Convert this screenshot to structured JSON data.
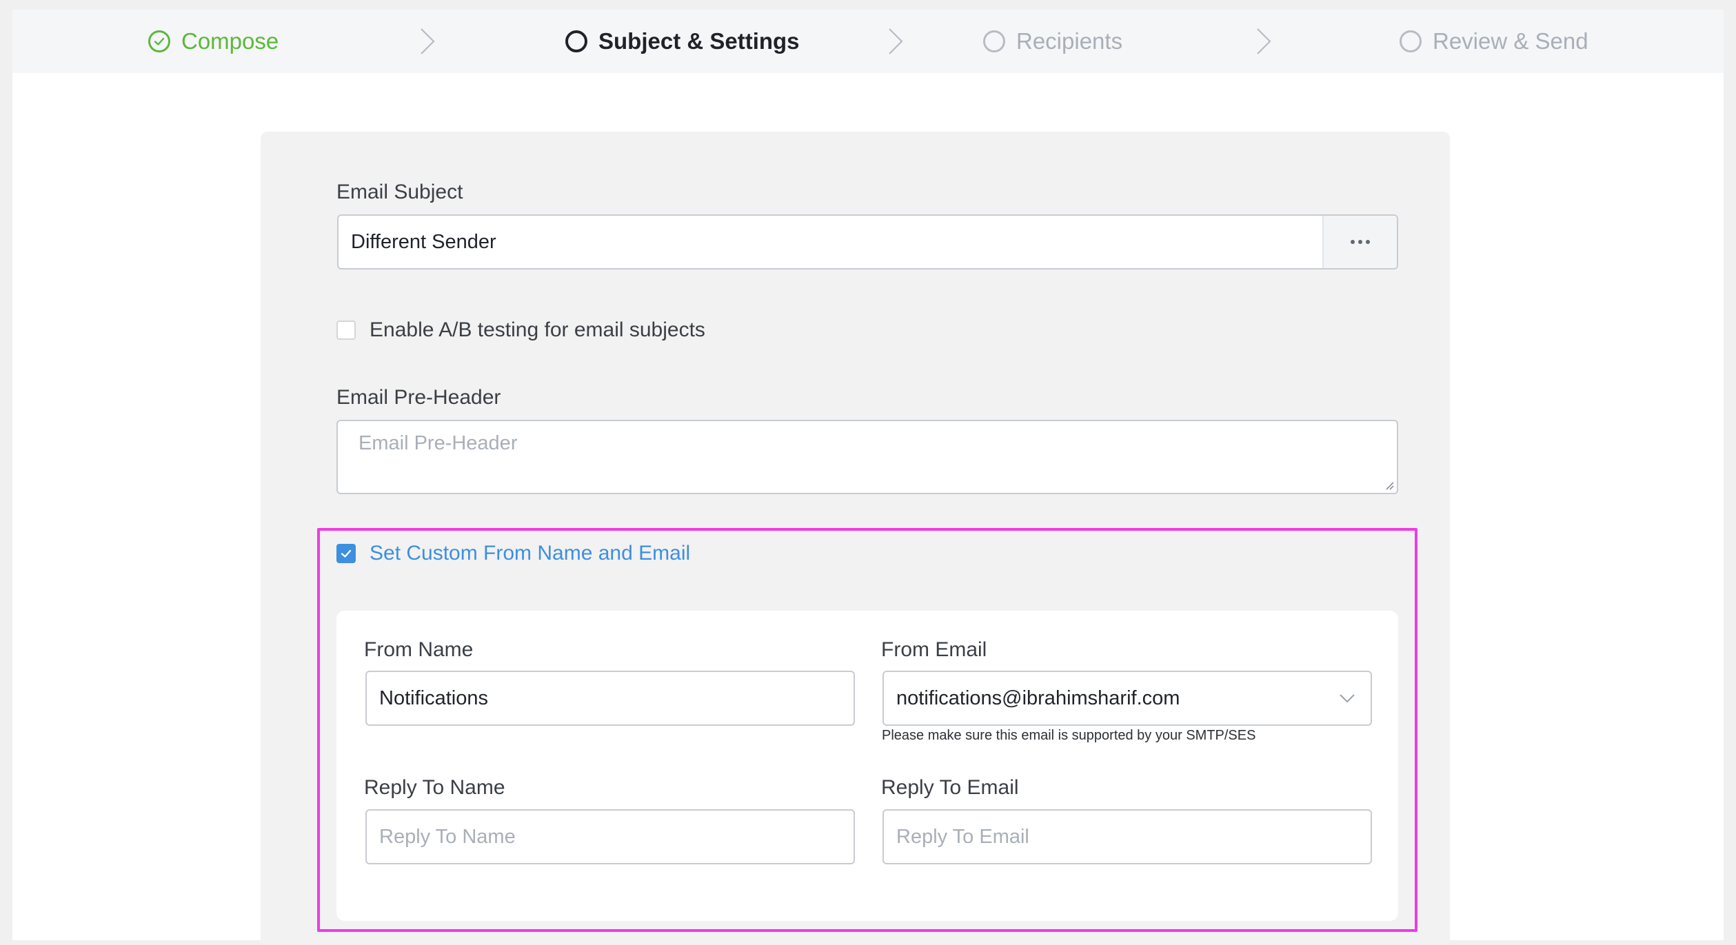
{
  "stepper": {
    "steps": [
      {
        "label": "Compose",
        "state": "done"
      },
      {
        "label": "Subject & Settings",
        "state": "active"
      },
      {
        "label": "Recipients",
        "state": "pending"
      },
      {
        "label": "Review & Send",
        "state": "pending"
      }
    ]
  },
  "form": {
    "subject_label": "Email Subject",
    "subject_value": "Different Sender",
    "ab_testing_label": "Enable A/B testing for email subjects",
    "ab_testing_checked": false,
    "preheader_label": "Email Pre-Header",
    "preheader_placeholder": "Email Pre-Header",
    "custom_from_label": "Set Custom From Name and Email",
    "custom_from_checked": true,
    "from_name_label": "From Name",
    "from_name_value": "Notifications",
    "from_email_label": "From Email",
    "from_email_value": "notifications@ibrahimsharif.com",
    "from_email_help": "Please make sure this email is supported by your SMTP/SES",
    "reply_name_label": "Reply To Name",
    "reply_name_placeholder": "Reply To Name",
    "reply_email_label": "Reply To Email",
    "reply_email_placeholder": "Reply To Email"
  },
  "colors": {
    "done": "#5cb83a",
    "active": "#1f2329",
    "pending": "#a9afb8",
    "accent": "#3d8fe0",
    "highlight": "#ee3ce6"
  }
}
